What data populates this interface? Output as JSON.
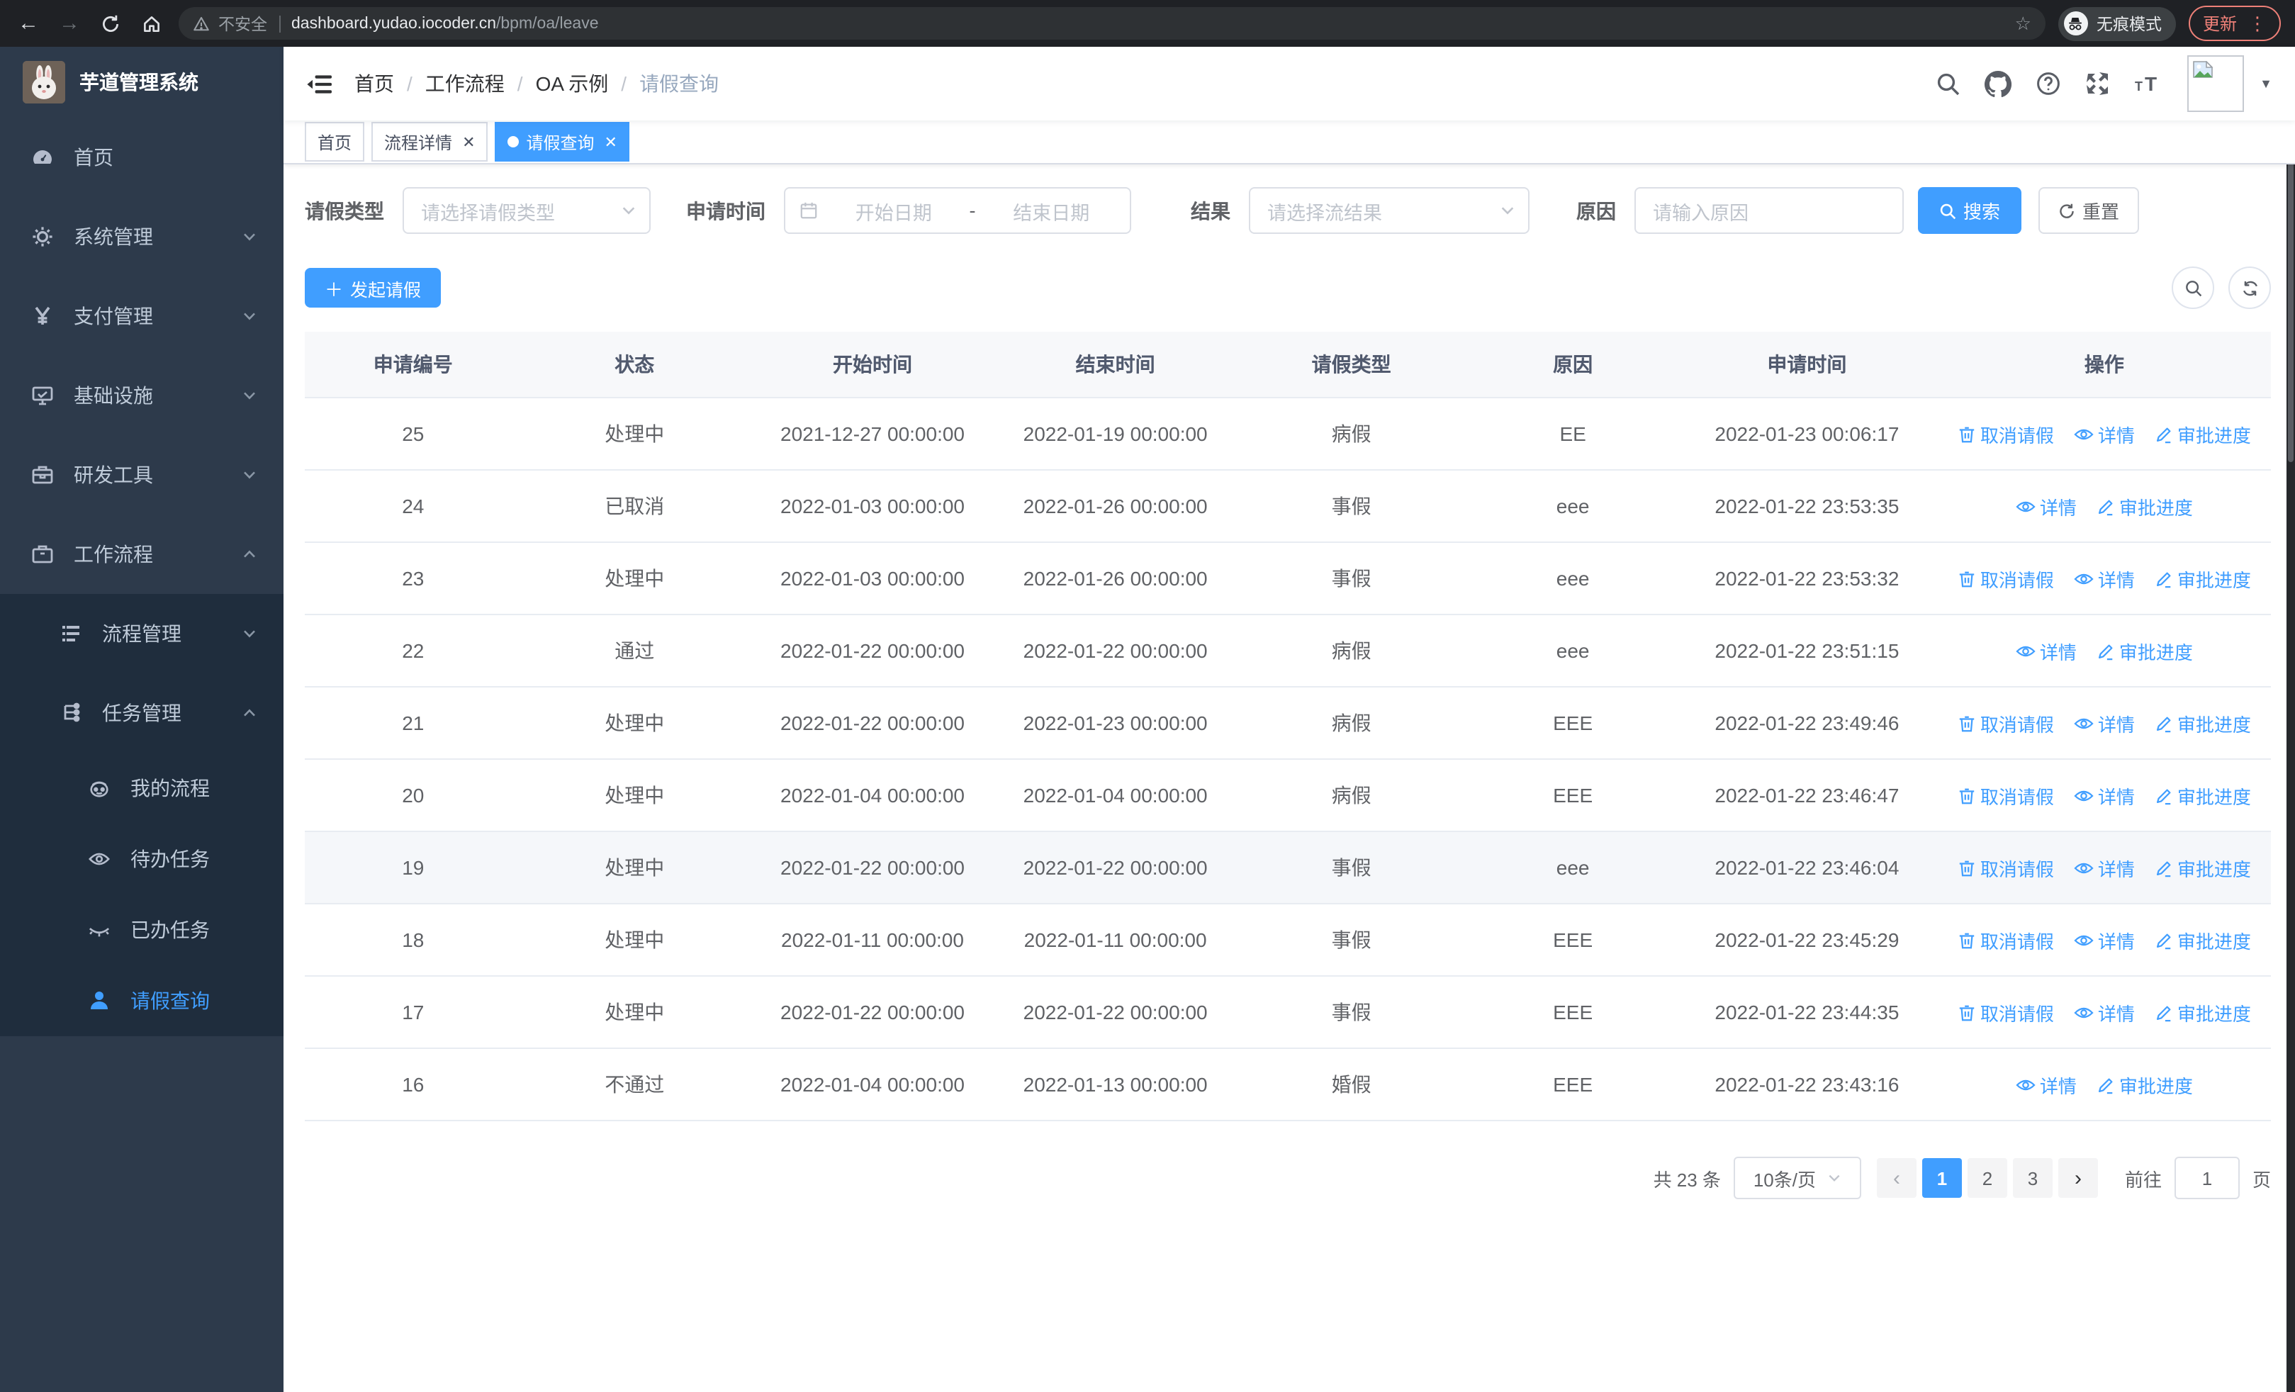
{
  "browser": {
    "security_label": "不安全",
    "url_host": "dashboard.yudao.iocoder.cn",
    "url_path": "/bpm/oa/leave",
    "incognito_label": "无痕模式",
    "update_label": "更新"
  },
  "sidebar": {
    "title": "芋道管理系统",
    "menu": [
      {
        "label": "首页",
        "icon": "dashboard-icon",
        "level": 1
      },
      {
        "label": "系统管理",
        "icon": "gear-icon",
        "level": 1,
        "chevron": "down"
      },
      {
        "label": "支付管理",
        "icon": "yen-icon",
        "level": 1,
        "chevron": "down"
      },
      {
        "label": "基础设施",
        "icon": "monitor-icon",
        "level": 1,
        "chevron": "down"
      },
      {
        "label": "研发工具",
        "icon": "toolbox-icon",
        "level": 1,
        "chevron": "down"
      },
      {
        "label": "工作流程",
        "icon": "briefcase-icon",
        "level": 1,
        "chevron": "up"
      },
      {
        "label": "流程管理",
        "icon": "list-icon",
        "level": 2,
        "chevron": "down",
        "group": true
      },
      {
        "label": "任务管理",
        "icon": "tree-icon",
        "level": 2,
        "chevron": "up",
        "group": true
      },
      {
        "label": "我的流程",
        "icon": "robot-icon",
        "level": 3,
        "group": true
      },
      {
        "label": "待办任务",
        "icon": "eye-icon",
        "level": 3,
        "group": true
      },
      {
        "label": "已办任务",
        "icon": "eye-closed-icon",
        "level": 3,
        "group": true
      },
      {
        "label": "请假查询",
        "icon": "user-icon",
        "level": 3,
        "group": true,
        "active": true
      }
    ]
  },
  "navbar": {
    "breadcrumb": [
      "首页",
      "工作流程",
      "OA 示例",
      "请假查询"
    ],
    "action_icons": [
      "search-icon",
      "github-icon",
      "help-icon",
      "fullscreen-icon",
      "font-size-icon"
    ]
  },
  "tags": [
    {
      "label": "首页",
      "closable": false,
      "active": false
    },
    {
      "label": "流程详情",
      "closable": true,
      "active": false
    },
    {
      "label": "请假查询",
      "closable": true,
      "active": true
    }
  ],
  "filters": {
    "leave_type_label": "请假类型",
    "leave_type_placeholder": "请选择请假类型",
    "apply_time_label": "申请时间",
    "start_date_placeholder": "开始日期",
    "range_separator": "-",
    "end_date_placeholder": "结束日期",
    "result_label": "结果",
    "result_placeholder": "请选择流结果",
    "reason_label": "原因",
    "reason_placeholder": "请输入原因",
    "search_label": "搜索",
    "reset_label": "重置"
  },
  "toolbar": {
    "create_label": "发起请假"
  },
  "table": {
    "columns": [
      "申请编号",
      "状态",
      "开始时间",
      "结束时间",
      "请假类型",
      "原因",
      "申请时间",
      "操作"
    ],
    "action_labels": {
      "cancel": "取消请假",
      "detail": "详情",
      "progress": "审批进度"
    },
    "rows": [
      {
        "id": "25",
        "status": "处理中",
        "start": "2021-12-27 00:00:00",
        "end": "2022-01-19 00:00:00",
        "type": "病假",
        "reason": "EE",
        "applied": "2022-01-23 00:06:17",
        "actions": [
          "cancel",
          "detail",
          "progress"
        ],
        "highlight": false
      },
      {
        "id": "24",
        "status": "已取消",
        "start": "2022-01-03 00:00:00",
        "end": "2022-01-26 00:00:00",
        "type": "事假",
        "reason": "eee",
        "applied": "2022-01-22 23:53:35",
        "actions": [
          "detail",
          "progress"
        ],
        "highlight": false
      },
      {
        "id": "23",
        "status": "处理中",
        "start": "2022-01-03 00:00:00",
        "end": "2022-01-26 00:00:00",
        "type": "事假",
        "reason": "eee",
        "applied": "2022-01-22 23:53:32",
        "actions": [
          "cancel",
          "detail",
          "progress"
        ],
        "highlight": false
      },
      {
        "id": "22",
        "status": "通过",
        "start": "2022-01-22 00:00:00",
        "end": "2022-01-22 00:00:00",
        "type": "病假",
        "reason": "eee",
        "applied": "2022-01-22 23:51:15",
        "actions": [
          "detail",
          "progress"
        ],
        "highlight": false
      },
      {
        "id": "21",
        "status": "处理中",
        "start": "2022-01-22 00:00:00",
        "end": "2022-01-23 00:00:00",
        "type": "病假",
        "reason": "EEE",
        "applied": "2022-01-22 23:49:46",
        "actions": [
          "cancel",
          "detail",
          "progress"
        ],
        "highlight": false
      },
      {
        "id": "20",
        "status": "处理中",
        "start": "2022-01-04 00:00:00",
        "end": "2022-01-04 00:00:00",
        "type": "病假",
        "reason": "EEE",
        "applied": "2022-01-22 23:46:47",
        "actions": [
          "cancel",
          "detail",
          "progress"
        ],
        "highlight": false
      },
      {
        "id": "19",
        "status": "处理中",
        "start": "2022-01-22 00:00:00",
        "end": "2022-01-22 00:00:00",
        "type": "事假",
        "reason": "eee",
        "applied": "2022-01-22 23:46:04",
        "actions": [
          "cancel",
          "detail",
          "progress"
        ],
        "highlight": true
      },
      {
        "id": "18",
        "status": "处理中",
        "start": "2022-01-11 00:00:00",
        "end": "2022-01-11 00:00:00",
        "type": "事假",
        "reason": "EEE",
        "applied": "2022-01-22 23:45:29",
        "actions": [
          "cancel",
          "detail",
          "progress"
        ],
        "highlight": false
      },
      {
        "id": "17",
        "status": "处理中",
        "start": "2022-01-22 00:00:00",
        "end": "2022-01-22 00:00:00",
        "type": "事假",
        "reason": "EEE",
        "applied": "2022-01-22 23:44:35",
        "actions": [
          "cancel",
          "detail",
          "progress"
        ],
        "highlight": false
      },
      {
        "id": "16",
        "status": "不通过",
        "start": "2022-01-04 00:00:00",
        "end": "2022-01-13 00:00:00",
        "type": "婚假",
        "reason": "EEE",
        "applied": "2022-01-22 23:43:16",
        "actions": [
          "detail",
          "progress"
        ],
        "highlight": false
      }
    ]
  },
  "pagination": {
    "total_label": "共 23 条",
    "page_size_label": "10条/页",
    "pages": [
      "1",
      "2",
      "3"
    ],
    "active_page": "1",
    "jump_label": "前往",
    "jump_value": "1",
    "jump_suffix": "页"
  },
  "colors": {
    "accent": "#409eff",
    "sidebar_bg": "#2d3a4b",
    "submenu_bg": "#1f2d3d",
    "chrome_bg": "#1f2125",
    "update_accent": "#ee8078"
  }
}
